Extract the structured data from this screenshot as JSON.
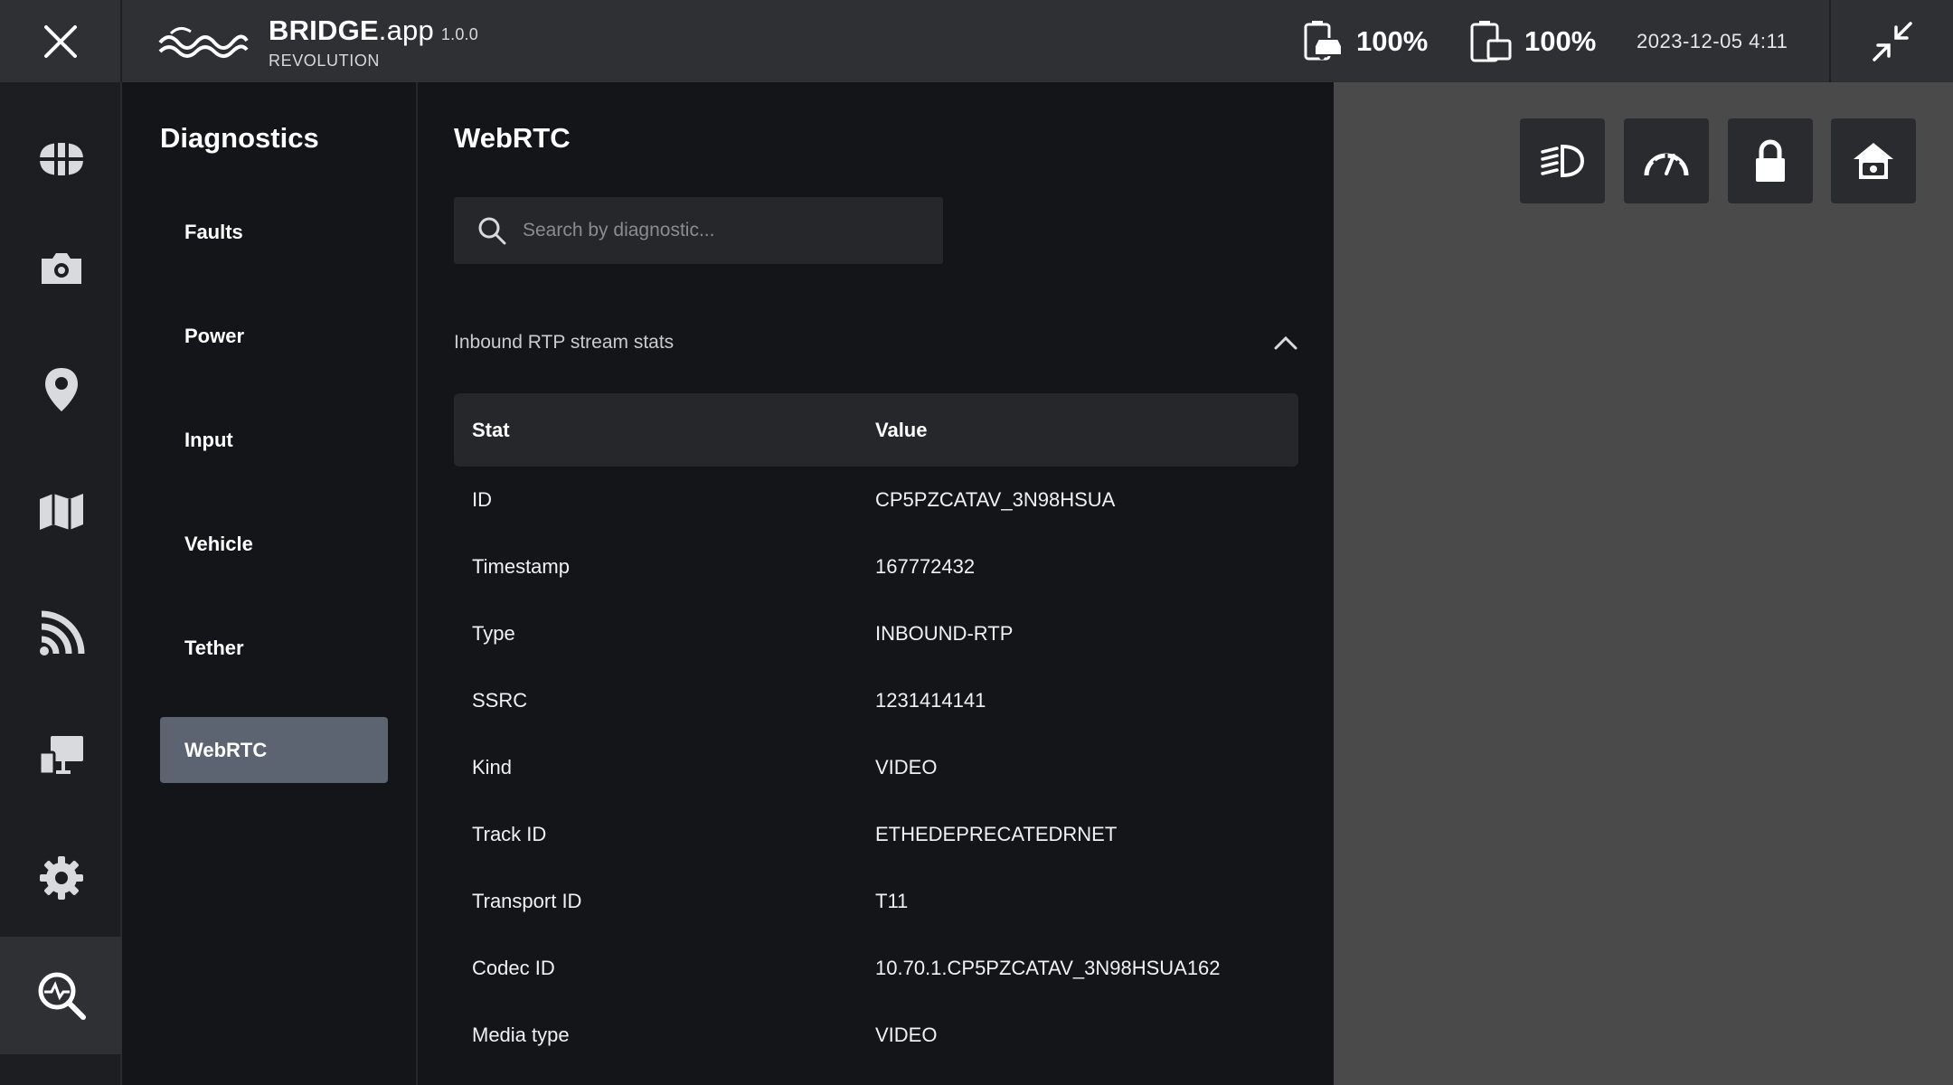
{
  "topbar": {
    "brand_name": "BRIDGE",
    "brand_suffix": ".app",
    "version": "1.0.0",
    "subtitle": "REVOLUTION",
    "vehicle_battery": "100%",
    "device_battery": "100%",
    "datetime": "2023-12-05 4:11",
    "icons": [
      "close-icon",
      "waves-logo",
      "vehicle-battery-icon",
      "tablet-battery-icon",
      "minimize-icon"
    ]
  },
  "rail": {
    "items": [
      {
        "name": "drive",
        "icon": "steering-icon"
      },
      {
        "name": "camera",
        "icon": "camera-icon"
      },
      {
        "name": "location",
        "icon": "location-pin-icon"
      },
      {
        "name": "map",
        "icon": "map-icon"
      },
      {
        "name": "stream",
        "icon": "signal-icon"
      },
      {
        "name": "display",
        "icon": "display-icon"
      },
      {
        "name": "settings",
        "icon": "gear-icon"
      },
      {
        "name": "diagnostics",
        "icon": "diagnostics-icon",
        "active": true
      }
    ]
  },
  "nav": {
    "title": "Diagnostics",
    "items": [
      {
        "label": "Faults"
      },
      {
        "label": "Power"
      },
      {
        "label": "Input"
      },
      {
        "label": "Vehicle"
      },
      {
        "label": "Tether"
      },
      {
        "label": "WebRTC",
        "active": true
      }
    ]
  },
  "main": {
    "title": "WebRTC",
    "search_placeholder": "Search by diagnostic...",
    "section_title": "Inbound RTP stream stats",
    "columns": [
      "Stat",
      "Value"
    ],
    "rows": [
      {
        "stat": "ID",
        "value": "CP5PZCATAV_3N98HSUA"
      },
      {
        "stat": "Timestamp",
        "value": "167772432"
      },
      {
        "stat": "Type",
        "value": "INBOUND-RTP"
      },
      {
        "stat": "SSRC",
        "value": "1231414141"
      },
      {
        "stat": "Kind",
        "value": "VIDEO"
      },
      {
        "stat": "Track ID",
        "value": "ETHEDEPRECATEDRNET"
      },
      {
        "stat": "Transport ID",
        "value": "T11"
      },
      {
        "stat": "Codec ID",
        "value": "10.70.1.CP5PZCATAV_3N98HSUA162"
      },
      {
        "stat": "Media type",
        "value": "VIDEO"
      }
    ]
  },
  "quick_actions": [
    "headlight-icon",
    "speedometer-icon",
    "lock-icon",
    "home-camera-icon"
  ],
  "colors": {
    "topbar": "#2f3034",
    "background": "#141518",
    "active_nav": "#5b6470",
    "right_panel": "#4a4a4a"
  }
}
